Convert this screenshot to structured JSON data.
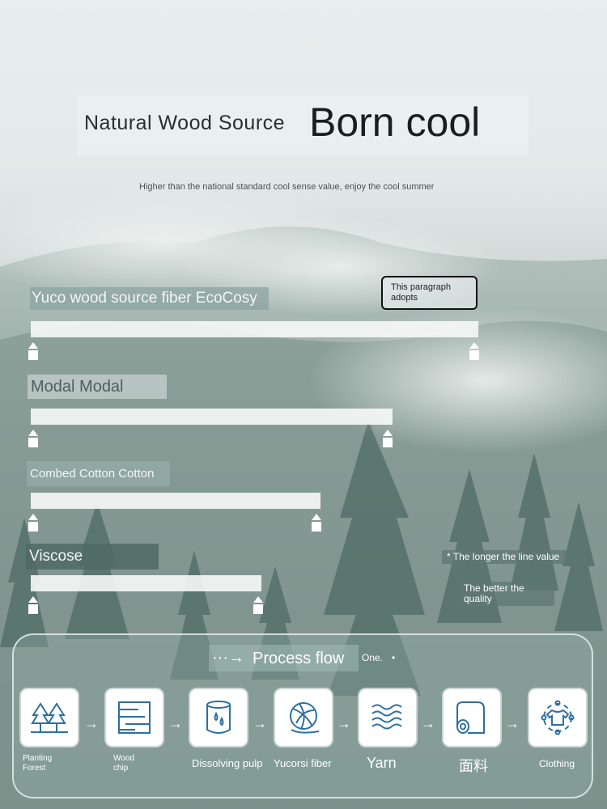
{
  "headline": {
    "left": "Natural Wood Source",
    "right": "Born cool"
  },
  "subtitle": "Higher than the national standard cool sense value, enjoy the cool summer",
  "note_box": "This paragraph adopts",
  "fibers": [
    {
      "label": "Yuco wood source fiber EcoCosy",
      "length_fraction": 1.0
    },
    {
      "label": "Modal Modal",
      "length_fraction": 0.81
    },
    {
      "label": "Combed Cotton Cotton",
      "length_fraction": 0.65
    },
    {
      "label": "Viscose",
      "length_fraction": 0.52
    }
  ],
  "side_notes": [
    "* The longer the line value",
    "The better the quality"
  ],
  "process": {
    "arrow": "···→",
    "title": "Process flow",
    "extra": "One.",
    "dot": "•",
    "steps": [
      {
        "label": "Planting Forest",
        "icon": "forest-icon"
      },
      {
        "label": "Wood chip",
        "icon": "wood-chip-icon"
      },
      {
        "label": "Dissolving pulp",
        "icon": "pulp-icon"
      },
      {
        "label": "Yucorsi fiber",
        "icon": "fiber-ball-icon"
      },
      {
        "label": "Yarn",
        "icon": "yarn-wave-icon"
      },
      {
        "label": "面料",
        "icon": "fabric-roll-icon"
      },
      {
        "label": "Clothing",
        "icon": "clothing-icon"
      }
    ]
  },
  "colors": {
    "icon_blue": "#2f6f9f",
    "label_dark": "#2a2f30"
  }
}
